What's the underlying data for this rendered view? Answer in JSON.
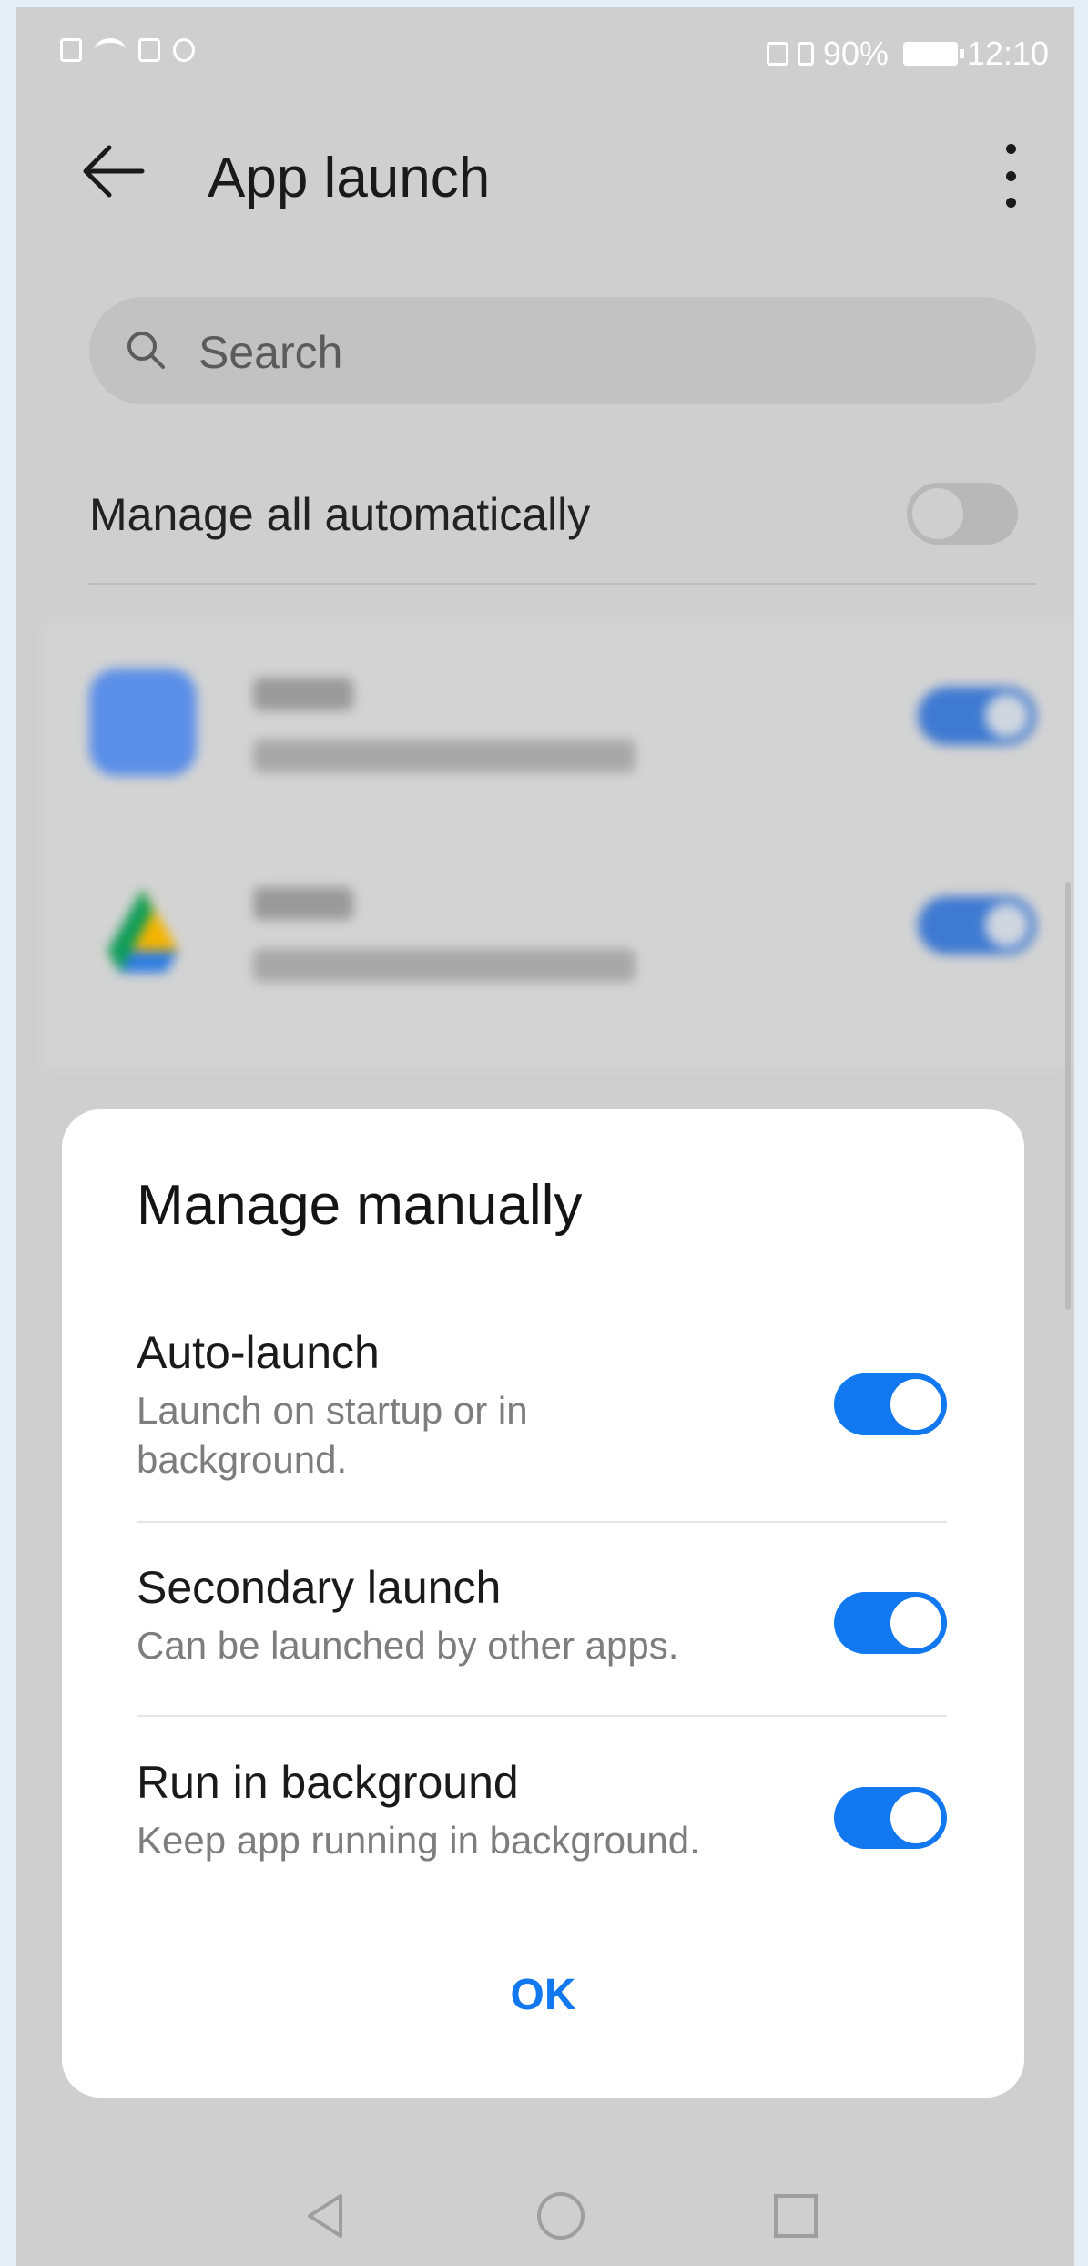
{
  "status_bar": {
    "left_icons": [
      "sim-alert-icon",
      "wifi-icon",
      "mail-icon",
      "vpn-icon"
    ],
    "right_icons": [
      "nfc-icon",
      "vibrate-icon",
      "battery-icon"
    ],
    "battery": "90%",
    "time": "12:10"
  },
  "header": {
    "title": "App launch"
  },
  "search": {
    "placeholder": "Search"
  },
  "manage_all": {
    "label": "Manage all automatically",
    "enabled": false
  },
  "dialog": {
    "title": "Manage manually",
    "options": [
      {
        "title": "Auto-launch",
        "subtitle": "Launch on startup or in background.",
        "enabled": true
      },
      {
        "title": "Secondary launch",
        "subtitle": "Can be launched by other apps.",
        "enabled": true
      },
      {
        "title": "Run in background",
        "subtitle": "Keep app running in background.",
        "enabled": true
      }
    ],
    "ok_label": "OK"
  },
  "colors": {
    "accent": "#1278f0",
    "scrim": "#cfcfcf",
    "dialog_bg": "#ffffff"
  }
}
